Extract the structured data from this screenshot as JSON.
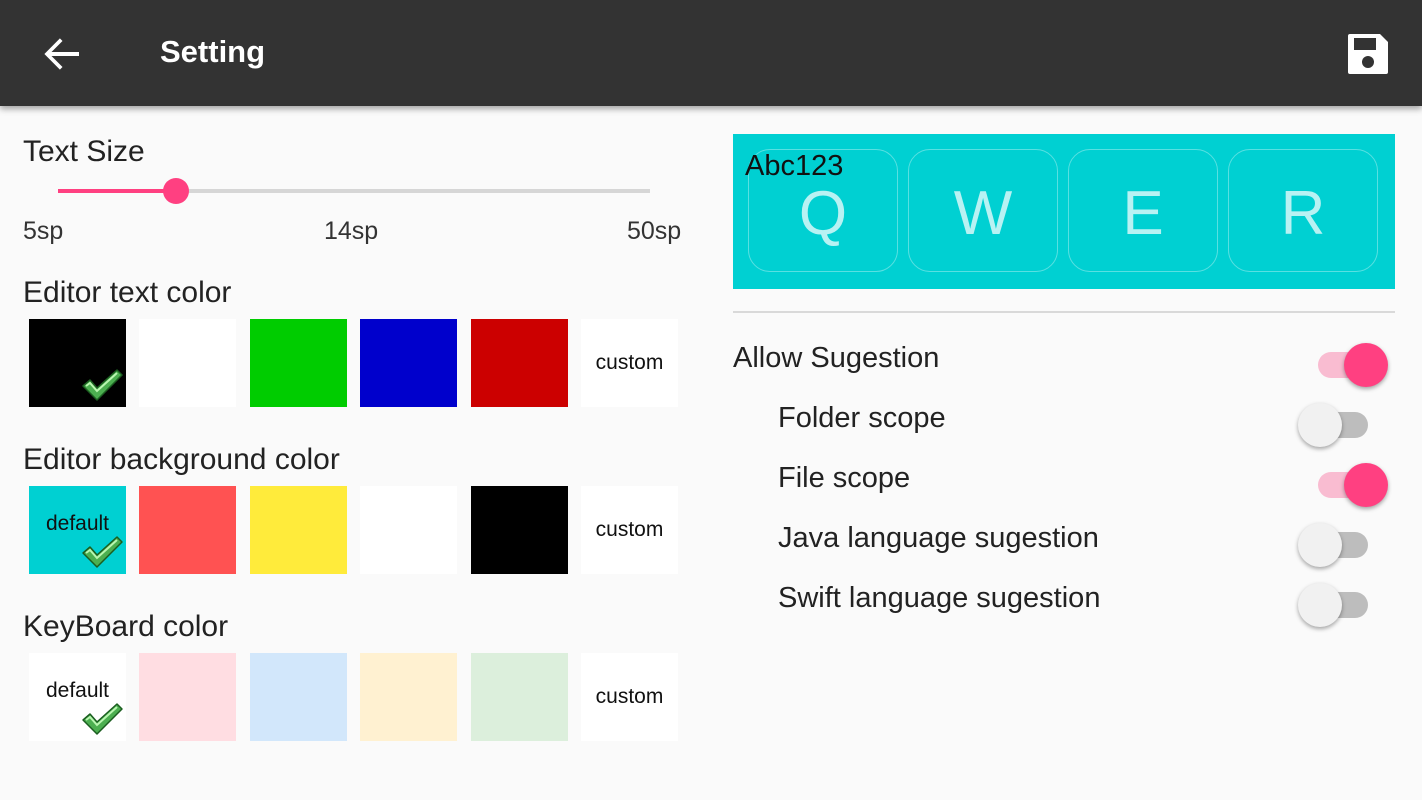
{
  "appbar": {
    "title": "Setting",
    "back_icon": "arrow-back-icon",
    "save_icon": "save-floppy-icon",
    "bg_color": "#333333"
  },
  "text_size": {
    "label": "Text Size",
    "min_label": "5sp",
    "mid_label": "14sp",
    "max_label": "50sp",
    "min": 5,
    "max": 50,
    "value": 14,
    "accent_color": "#ff4081"
  },
  "editor_text_color": {
    "label": "Editor text color",
    "swatches": [
      {
        "color": "#000000",
        "text": "",
        "selected": true
      },
      {
        "color": "#ffffff",
        "text": "",
        "selected": false
      },
      {
        "color": "#00cc00",
        "text": "",
        "selected": false
      },
      {
        "color": "#0000cc",
        "text": "",
        "selected": false
      },
      {
        "color": "#cc0000",
        "text": "",
        "selected": false
      },
      {
        "color": "#ffffff",
        "text": "custom",
        "selected": false
      }
    ]
  },
  "editor_background_color": {
    "label": "Editor background color",
    "swatches": [
      {
        "color": "#00d0d2",
        "text": "default",
        "selected": true
      },
      {
        "color": "#ff5252",
        "text": "",
        "selected": false
      },
      {
        "color": "#ffeb3b",
        "text": "",
        "selected": false
      },
      {
        "color": "#ffffff",
        "text": "",
        "selected": false
      },
      {
        "color": "#000000",
        "text": "",
        "selected": false
      },
      {
        "color": "#ffffff",
        "text": "custom",
        "selected": false
      }
    ]
  },
  "keyboard_color": {
    "label": "KeyBoard color",
    "swatches": [
      {
        "color": "#ffffff",
        "text": "default",
        "selected": true
      },
      {
        "color": "#ffdde2",
        "text": "",
        "selected": false
      },
      {
        "color": "#d2e7fb",
        "text": "",
        "selected": false
      },
      {
        "color": "#fff1d1",
        "text": "",
        "selected": false
      },
      {
        "color": "#dcefdc",
        "text": "",
        "selected": false
      },
      {
        "color": "#ffffff",
        "text": "custom",
        "selected": false
      }
    ]
  },
  "preview": {
    "text": "Abc123",
    "bg_color": "#00d0d2",
    "keys": [
      "Q",
      "W",
      "E",
      "R"
    ]
  },
  "preferences": [
    {
      "label": "Allow Sugestion",
      "on": true,
      "indent": false
    },
    {
      "label": "Folder scope",
      "on": false,
      "indent": true
    },
    {
      "label": "File scope",
      "on": true,
      "indent": true
    },
    {
      "label": "Java language sugestion",
      "on": false,
      "indent": true
    },
    {
      "label": "Swift language sugestion",
      "on": false,
      "indent": true
    }
  ]
}
